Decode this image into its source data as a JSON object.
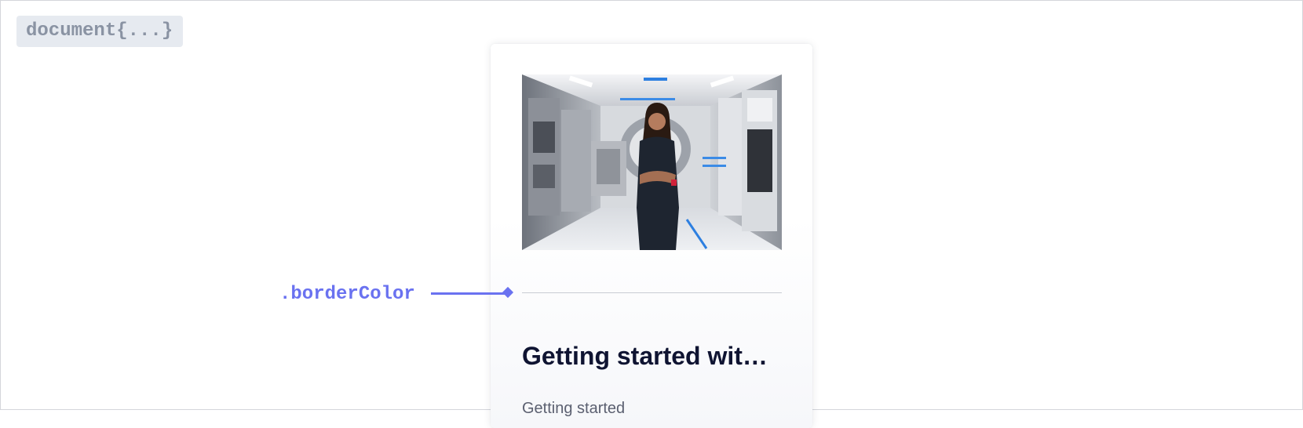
{
  "document_tag": "document{...}",
  "annotation": {
    "label": ".borderColor",
    "color": "#6a72f0"
  },
  "card": {
    "image_alt": "Woman standing in a space station corridor",
    "title": "Getting started with ...",
    "text": "Getting started"
  }
}
